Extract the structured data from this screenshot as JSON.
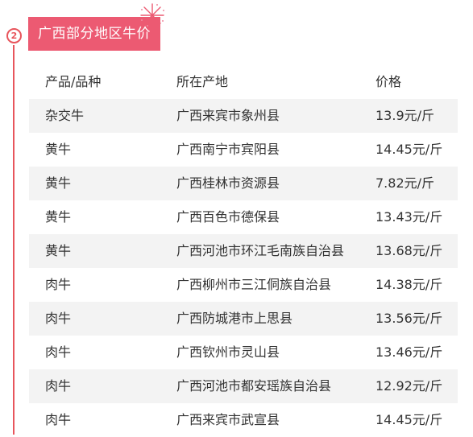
{
  "section": {
    "step_number": "2",
    "title": "广西部分地区牛价"
  },
  "table": {
    "columns": [
      "产品/品种",
      "所在产地",
      "价格"
    ],
    "rows": [
      [
        "杂交牛",
        "广西来宾市象州县",
        "13.9元/斤"
      ],
      [
        "黄牛",
        "广西南宁市宾阳县",
        "14.45元/斤"
      ],
      [
        "黄牛",
        "广西桂林市资源县",
        "7.82元/斤"
      ],
      [
        "黄牛",
        "广西百色市德保县",
        "13.43元/斤"
      ],
      [
        "黄牛",
        "广西河池市环江毛南族自治县",
        "13.68元/斤"
      ],
      [
        "肉牛",
        "广西柳州市三江侗族自治县",
        "14.38元/斤"
      ],
      [
        "肉牛",
        "广西防城港市上思县",
        "13.56元/斤"
      ],
      [
        "肉牛",
        "广西钦州市灵山县",
        "13.46元/斤"
      ],
      [
        "肉牛",
        "广西河池市都安瑶族自治县",
        "12.92元/斤"
      ],
      [
        "肉牛",
        "广西来宾市武宣县",
        "14.45元/斤"
      ]
    ]
  },
  "colors": {
    "accent": "#ec5a72",
    "timeline": "#e8555c",
    "row_shade": "#f3f3f3"
  },
  "icons": {
    "badge": "step-number-circle",
    "decoration": "firework-icon"
  }
}
